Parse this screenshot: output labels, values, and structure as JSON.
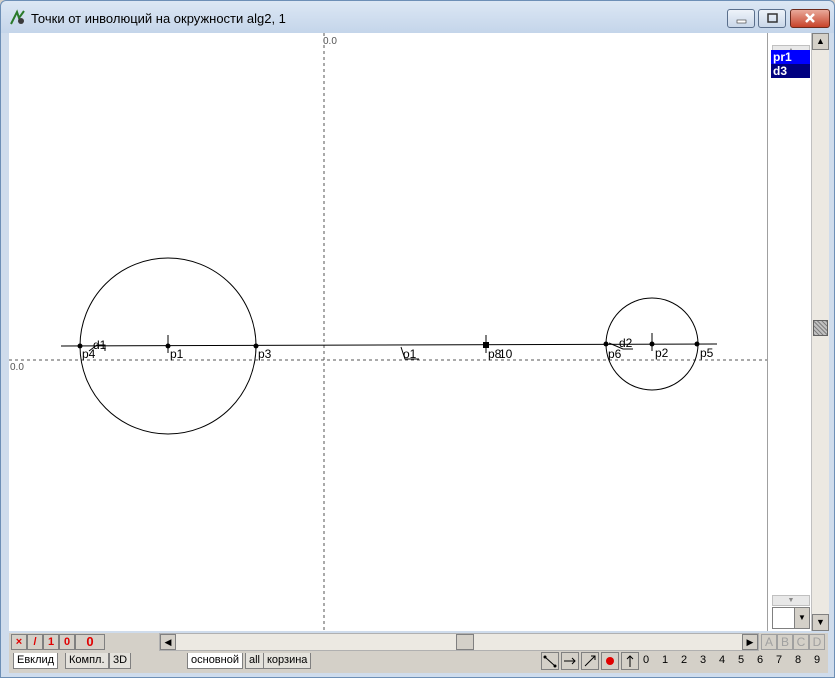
{
  "window": {
    "title": "Точки от инволюций на окружности alg2, 1",
    "buttons": {
      "minimize": "minimize-icon",
      "maximize": "maximize-icon",
      "close": "close-icon"
    }
  },
  "canvas": {
    "axis_label_x": "0.0",
    "axis_label_y": "0.0",
    "labels": {
      "d1": "d1",
      "p4": "p4",
      "p1": "p1",
      "p3": "p3",
      "o1": "o1",
      "p8": "p8",
      "p10": "10",
      "d2": "d2",
      "p6": "p6",
      "p2": "p2",
      "p5": "p5"
    }
  },
  "right_panel": {
    "list": [
      "pr1",
      "d3"
    ]
  },
  "bottom_bar": {
    "indicators": [
      "×",
      "/",
      "1",
      "0"
    ],
    "counter": "0",
    "abcd": [
      "A",
      "B",
      "C",
      "D"
    ]
  },
  "tabs": {
    "left": [
      "Евклид",
      "Компл.",
      "3D"
    ],
    "layers": [
      "основной",
      "all",
      "корзина"
    ]
  },
  "numbers": [
    "0",
    "1",
    "2",
    "3",
    "4",
    "5",
    "6",
    "7",
    "8",
    "9"
  ],
  "colors": {
    "accent_red": "#e00000",
    "selection": "#0000ff",
    "selection_dark": "#000080"
  }
}
